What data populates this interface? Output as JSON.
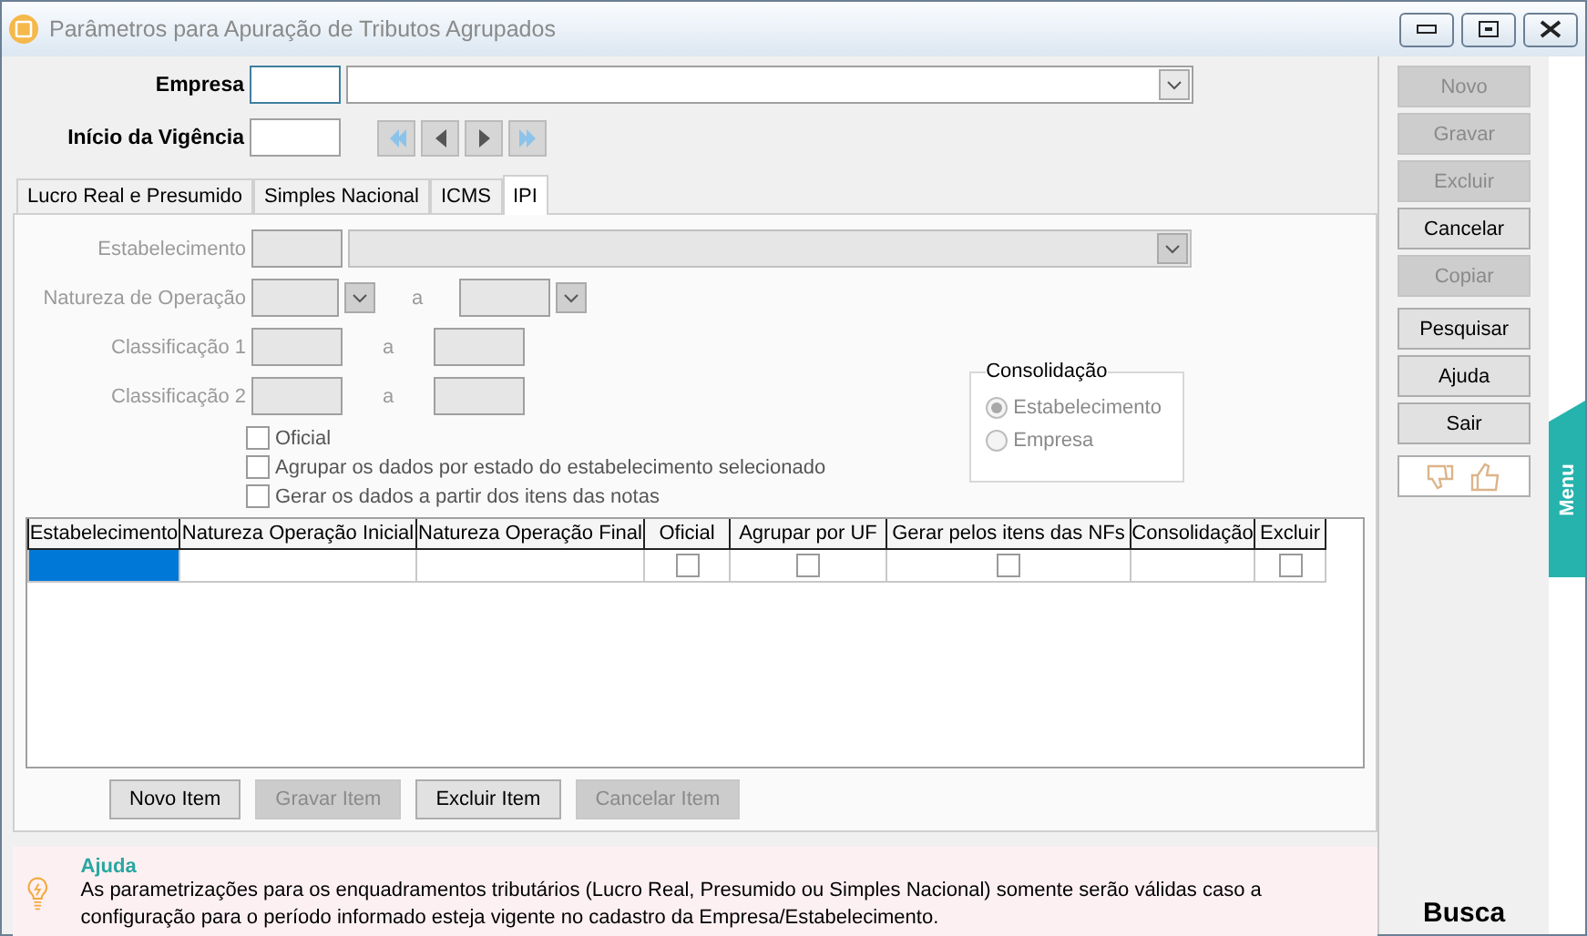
{
  "window": {
    "title": "Parâmetros para Apuração de Tributos Agrupados"
  },
  "header": {
    "company_label": "Empresa",
    "start_label": "Início da Vigência"
  },
  "tabs": [
    {
      "label": "Lucro Real e Presumido",
      "selected": false
    },
    {
      "label": "Simples Nacional",
      "selected": false
    },
    {
      "label": "ICMS",
      "selected": false
    },
    {
      "label": "IPI",
      "selected": true
    }
  ],
  "form": {
    "fields": [
      {
        "label": "Estabelecimento",
        "kind": "lookup",
        "disabled": true
      },
      {
        "label": "Natureza de Operação",
        "kind": "range_select",
        "separator": "a",
        "disabled": true
      },
      {
        "label": "Classificação 1",
        "kind": "range",
        "separator": "a",
        "disabled": true
      },
      {
        "label": "Classificação 2",
        "kind": "range",
        "separator": "a",
        "disabled": true
      }
    ],
    "checkboxes": [
      {
        "label": "Oficial",
        "checked": false
      },
      {
        "label": "Agrupar os dados por estado do estabelecimento selecionado",
        "checked": false
      },
      {
        "label": "Gerar os dados a partir dos itens das notas",
        "checked": false
      }
    ],
    "consolidation": {
      "title": "Consolidação",
      "disabled": true,
      "options": [
        {
          "label": "Estabelecimento",
          "selected": true
        },
        {
          "label": "Empresa",
          "selected": false
        }
      ]
    }
  },
  "grid": {
    "columns": [
      "Estabelecimento",
      "Natureza Operação Inicial",
      "Natureza Operação Final",
      "Oficial",
      "Agrupar por UF",
      "Gerar pelos itens das NFs",
      "Consolidação",
      "Excluir"
    ],
    "rows": [
      {
        "cells": [
          {
            "kind": "text",
            "selected": true
          },
          {
            "kind": "text",
            "selected": false
          },
          {
            "kind": "text",
            "selected": false
          },
          {
            "kind": "check",
            "checked": false
          },
          {
            "kind": "check",
            "checked": false
          },
          {
            "kind": "check",
            "checked": false
          },
          {
            "kind": "text",
            "selected": false
          },
          {
            "kind": "check",
            "checked": false
          }
        ]
      }
    ]
  },
  "item_buttons": [
    {
      "label": "Novo Item",
      "disabled": false
    },
    {
      "label": "Gravar Item",
      "disabled": true
    },
    {
      "label": "Excluir Item",
      "disabled": false
    },
    {
      "label": "Cancelar Item",
      "disabled": true
    }
  ],
  "help": {
    "title": "Ajuda",
    "text": "As parametrizações para os enquadramentos tributários (Lucro Real, Presumido ou Simples Nacional) somente serão válidas caso a configuração para o período informado esteja vigente no cadastro da Empresa/Estabelecimento."
  },
  "side_groups": [
    [
      {
        "label": "Novo",
        "disabled": true
      },
      {
        "label": "Gravar",
        "disabled": true
      },
      {
        "label": "Excluir",
        "disabled": true
      },
      {
        "label": "Cancelar",
        "disabled": false
      },
      {
        "label": "Copiar",
        "disabled": true
      }
    ],
    [
      {
        "label": "Pesquisar",
        "disabled": false
      },
      {
        "label": "Ajuda",
        "disabled": false
      },
      {
        "label": "Sair",
        "disabled": false
      }
    ]
  ],
  "menu_tab": {
    "label": "Menu"
  },
  "search_label": "Busca"
}
